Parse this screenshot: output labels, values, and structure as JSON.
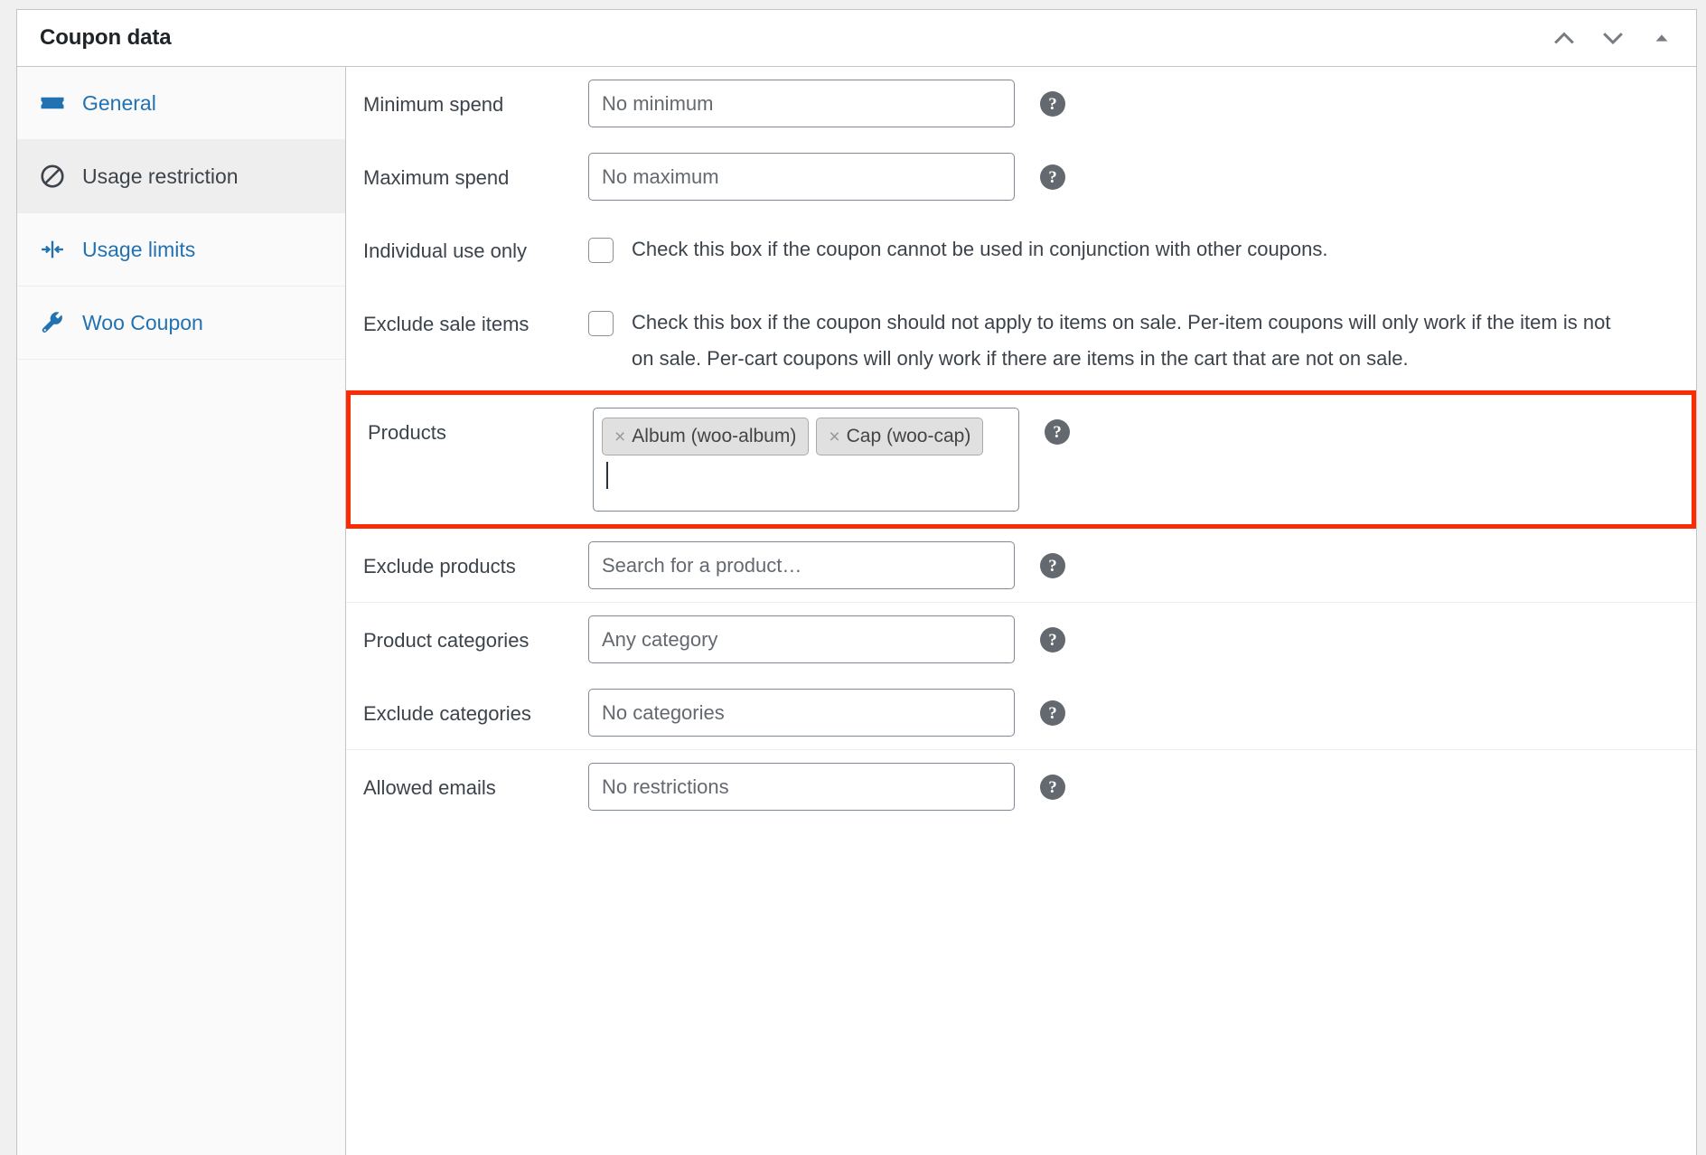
{
  "header": {
    "title": "Coupon data",
    "actions": [
      {
        "name": "move-up-button",
        "icon": "chevron-up-icon"
      },
      {
        "name": "move-down-button",
        "icon": "chevron-down-icon"
      },
      {
        "name": "toggle-panel-button",
        "icon": "triangle-up-icon"
      }
    ]
  },
  "sidebar": {
    "items": [
      {
        "label": "General",
        "icon": "ticket-icon",
        "active": false
      },
      {
        "label": "Usage restriction",
        "icon": "no-entry-icon",
        "active": true
      },
      {
        "label": "Usage limits",
        "icon": "arrows-inward-icon",
        "active": false
      },
      {
        "label": "Woo Coupon",
        "icon": "wrench-icon",
        "active": false
      }
    ]
  },
  "form": {
    "help_glyph": "?",
    "minimum_spend": {
      "label": "Minimum spend",
      "placeholder": "No minimum",
      "value": ""
    },
    "maximum_spend": {
      "label": "Maximum spend",
      "placeholder": "No maximum",
      "value": ""
    },
    "individual_use": {
      "label": "Individual use only",
      "description": "Check this box if the coupon cannot be used in conjunction with other coupons.",
      "checked": false
    },
    "exclude_sale_items": {
      "label": "Exclude sale items",
      "description": "Check this box if the coupon should not apply to items on sale. Per-item coupons will only work if the item is not on sale. Per-cart coupons will only work if there are items in the cart that are not on sale.",
      "checked": false
    },
    "products": {
      "label": "Products",
      "highlighted": true,
      "highlight_color": "#fb2c04",
      "tokens": [
        {
          "remove_glyph": "×",
          "label": "Album (woo-album)"
        },
        {
          "remove_glyph": "×",
          "label": "Cap (woo-cap)"
        }
      ],
      "input_value": "",
      "focused": true
    },
    "exclude_products": {
      "label": "Exclude products",
      "placeholder": "Search for a product…",
      "value": ""
    },
    "product_categories": {
      "label": "Product categories",
      "placeholder": "Any category",
      "value": ""
    },
    "exclude_categories": {
      "label": "Exclude categories",
      "placeholder": "No categories",
      "value": ""
    },
    "allowed_emails": {
      "label": "Allowed emails",
      "placeholder": "No restrictions",
      "value": ""
    }
  }
}
